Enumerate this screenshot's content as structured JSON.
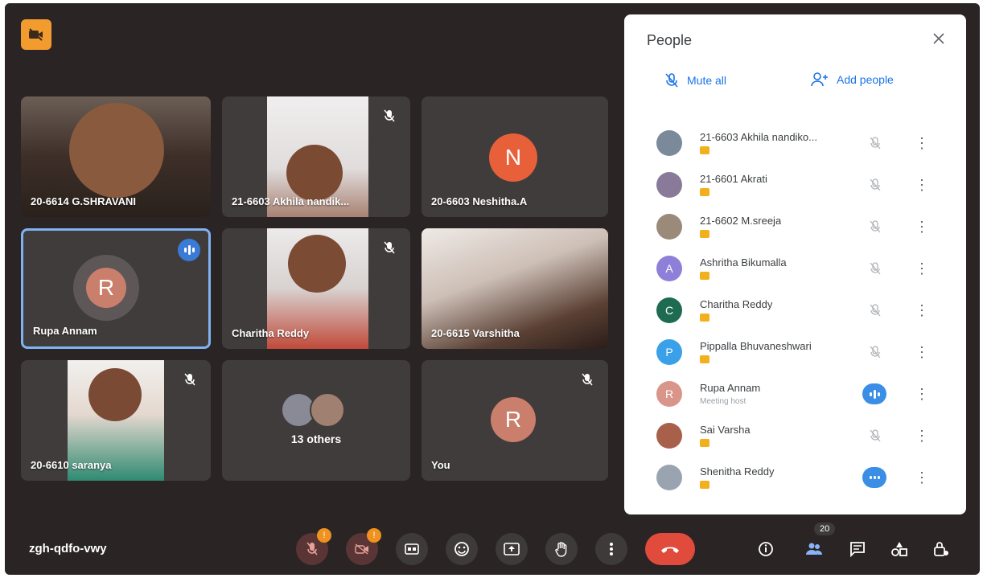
{
  "meeting": {
    "code": "zgh-qdfo-vwy",
    "participant_count": "20"
  },
  "tiles": [
    {
      "name": "20-6614 G.SHRAVANI"
    },
    {
      "name": "21-6603 Akhila nandik..."
    },
    {
      "name": "20-6603 Neshitha.A",
      "initial": "N"
    },
    {
      "name": "Rupa Annam",
      "initial": "R"
    },
    {
      "name": "Charitha Reddy"
    },
    {
      "name": "20-6615 Varshitha"
    },
    {
      "name": "20-6610 saranya"
    },
    {
      "name": "You",
      "initial": "R"
    }
  ],
  "others": {
    "label": "13 others"
  },
  "people_panel": {
    "title": "People",
    "mute_all": "Mute all",
    "add_people": "Add people",
    "participants": [
      {
        "name": "21-6603 Akhila nandiko...",
        "initial": ""
      },
      {
        "name": "21-6601 Akrati",
        "initial": ""
      },
      {
        "name": "21-6602 M.sreeja",
        "initial": ""
      },
      {
        "name": "Ashritha Bikumalla",
        "initial": "A"
      },
      {
        "name": "Charitha Reddy",
        "initial": "C"
      },
      {
        "name": "Pippalla Bhuvaneshwari",
        "initial": "P"
      },
      {
        "name": "Rupa Annam",
        "initial": "R",
        "subtitle": "Meeting host"
      },
      {
        "name": "Sai Varsha",
        "initial": ""
      },
      {
        "name": "Shenitha Reddy",
        "initial": ""
      }
    ]
  },
  "controls": {
    "mic_badge": "!",
    "camera_badge": "!"
  },
  "colors": {
    "accent": "#1a73e8",
    "end_call": "#e14b3c",
    "badge": "#f0921f",
    "background": "#2a2424"
  }
}
